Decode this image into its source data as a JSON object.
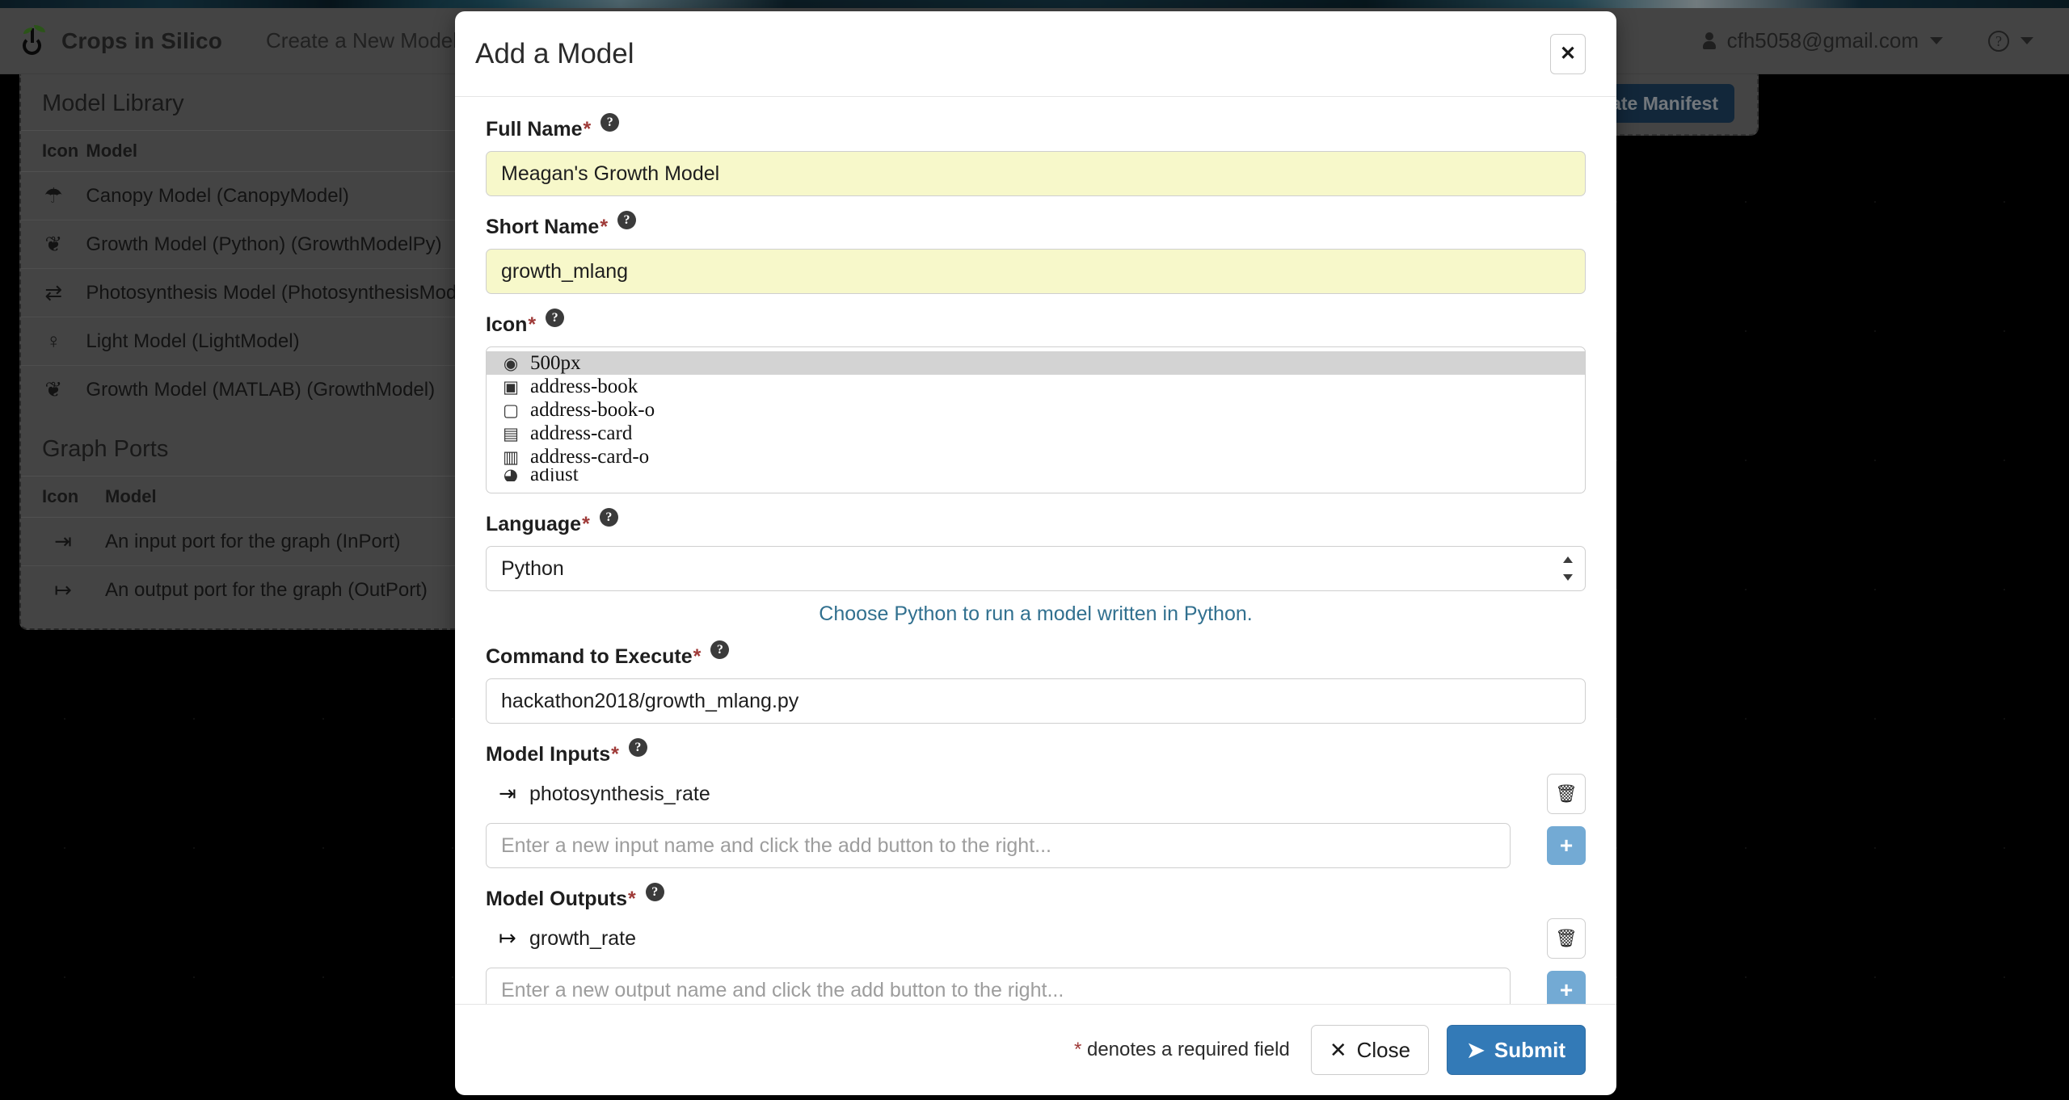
{
  "navbar": {
    "brand": "Crops in Silico",
    "nav_link": "Create a New Model",
    "user_email": "cfh5058@gmail.com",
    "help_glyph": "?"
  },
  "toolbar": {
    "generate_manifest_label": "Generate Manifest"
  },
  "model_library": {
    "heading": "Model Library",
    "columns": [
      "Icon",
      "Model"
    ],
    "rows": [
      {
        "icon": "☂",
        "label": "Canopy Model (CanopyModel)"
      },
      {
        "icon": "❦",
        "label": "Growth Model (Python) (GrowthModelPy)"
      },
      {
        "icon": "⇄",
        "label": "Photosynthesis Model (PhotosynthesisModel)"
      },
      {
        "icon": "♀",
        "label": "Light Model (LightModel)"
      },
      {
        "icon": "❦",
        "label": "Growth Model (MATLAB) (GrowthModel)"
      }
    ]
  },
  "graph_ports": {
    "heading": "Graph Ports",
    "columns": [
      "Icon",
      "Model"
    ],
    "rows": [
      {
        "icon": "⇥",
        "label": "An input port for the graph (InPort)"
      },
      {
        "icon": "↦",
        "label": "An output port for the graph (OutPort)"
      }
    ]
  },
  "modal": {
    "title": "Add a Model",
    "close_glyph": "✕",
    "full_name": {
      "label": "Full Name",
      "value": "Meagan's Growth Model",
      "placeholder": ""
    },
    "short_name": {
      "label": "Short Name",
      "value": "growth_mlang",
      "placeholder": ""
    },
    "icon": {
      "label": "Icon",
      "selected": "500px",
      "options": [
        {
          "glyph": "◉",
          "label": "500px",
          "selected": true
        },
        {
          "glyph": "▣",
          "label": "address-book",
          "selected": false
        },
        {
          "glyph": "▢",
          "label": "address-book-o",
          "selected": false
        },
        {
          "glyph": "▤",
          "label": "address-card",
          "selected": false
        },
        {
          "glyph": "▥",
          "label": "address-card-o",
          "selected": false
        },
        {
          "glyph": "◕",
          "label": "adjust",
          "selected": false
        }
      ]
    },
    "language": {
      "label": "Language",
      "value": "Python",
      "hint": "Choose Python to run a model written in Python."
    },
    "command": {
      "label": "Command to Execute",
      "value": "hackathon2018/growth_mlang.py",
      "placeholder": ""
    },
    "model_inputs": {
      "label": "Model Inputs",
      "items": [
        {
          "glyph": "⇥",
          "name": "photosynthesis_rate"
        }
      ],
      "new_placeholder": "Enter a new input name and click the add button to the right...",
      "new_value": "",
      "add_glyph": "+",
      "delete_glyph": "🗑"
    },
    "model_outputs": {
      "label": "Model Outputs",
      "items": [
        {
          "glyph": "↦",
          "name": "growth_rate"
        }
      ],
      "new_placeholder": "Enter a new output name and click the add button to the right...",
      "new_value": "",
      "add_glyph": "+",
      "delete_glyph": "🗑"
    },
    "footer": {
      "required_star": "*",
      "required_note": " denotes a required field",
      "close_label": "Close",
      "close_glyph": "✕",
      "submit_label": "Submit",
      "submit_glyph": "➤"
    },
    "required_marker": "*",
    "help_glyph": "?"
  },
  "colors": {
    "accent_blue": "#337ab7",
    "add_button_blue": "#73aad4",
    "hint_blue": "#31708f",
    "required_red": "#9f3a38",
    "field_yellow": "#f7f8ca",
    "navbar_gray": "#7d7d7d",
    "manifest_blue": "#21486a"
  }
}
